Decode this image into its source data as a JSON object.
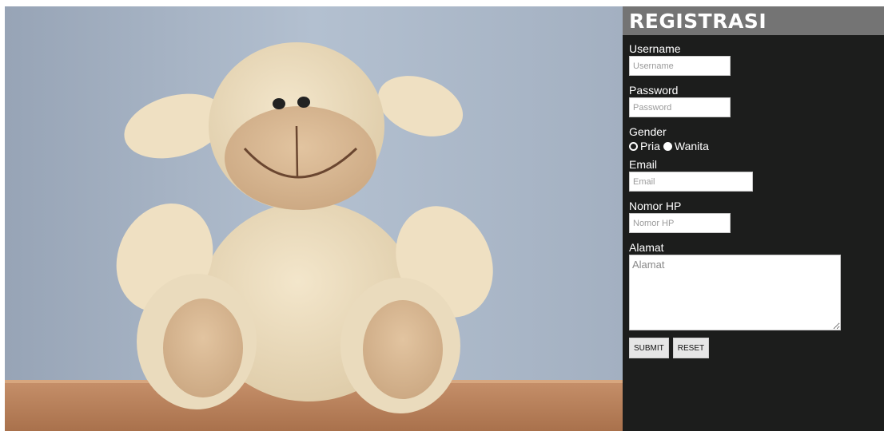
{
  "hero": {
    "alt_icon": "teddy-sheep-photo"
  },
  "form": {
    "title": "REGISTRASI",
    "username": {
      "label": "Username",
      "placeholder": "Username"
    },
    "password": {
      "label": "Password",
      "placeholder": "Password"
    },
    "gender": {
      "label": "Gender",
      "options": [
        "Pria",
        "Wanita"
      ],
      "selected": "Wanita"
    },
    "email": {
      "label": "Email",
      "placeholder": "Email"
    },
    "nomor_hp": {
      "label": "Nomor HP",
      "placeholder": "Nomor HP"
    },
    "alamat": {
      "label": "Alamat",
      "placeholder": "Alamat"
    },
    "submit_label": "SUBMIT",
    "reset_label": "RESET"
  },
  "colors": {
    "panel_bg": "#1c1d1c",
    "title_bg": "#747474"
  }
}
